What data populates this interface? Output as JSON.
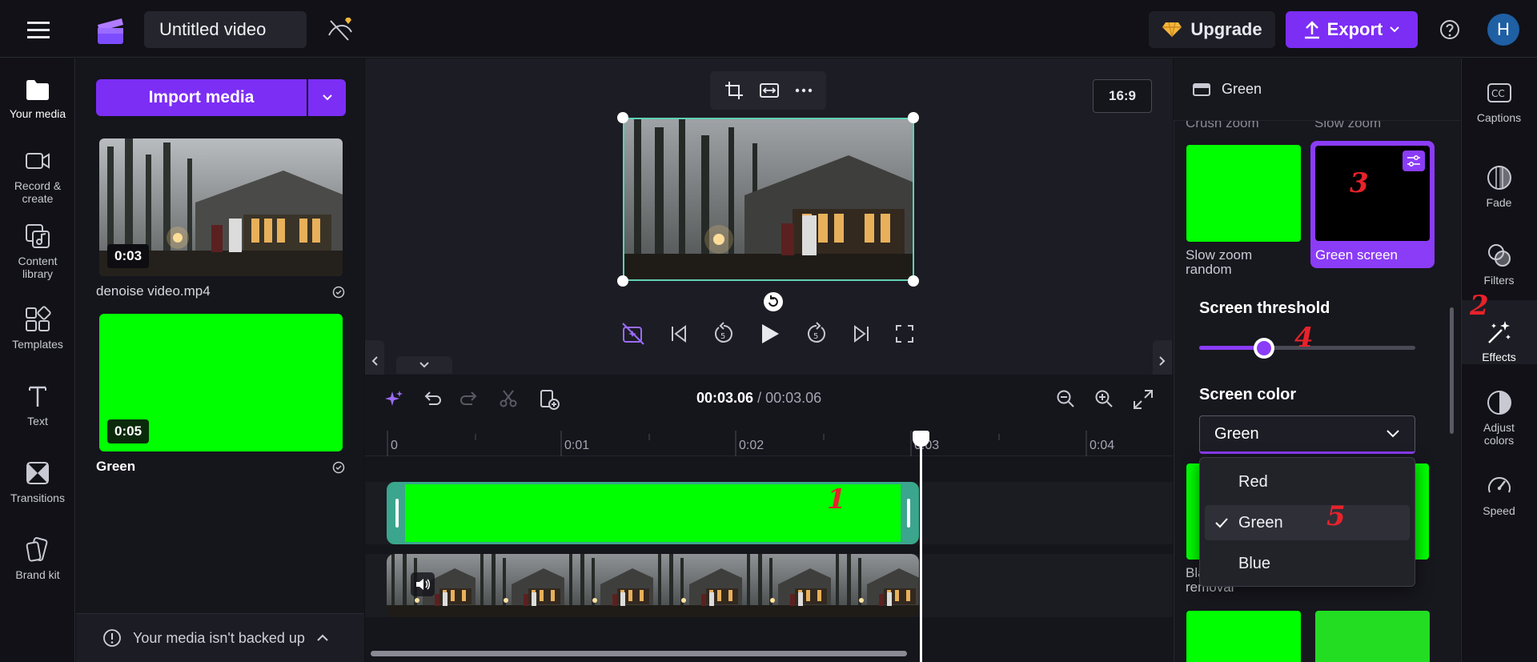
{
  "header": {
    "project_title": "Untitled video",
    "upgrade_label": "Upgrade",
    "export_label": "Export",
    "avatar_initial": "H"
  },
  "left_nav": {
    "items": [
      {
        "label": "Your media",
        "icon": "folder-icon"
      },
      {
        "label": "Record &\ncreate",
        "icon": "camera-icon"
      },
      {
        "label": "Content\nlibrary",
        "icon": "content-library-icon"
      },
      {
        "label": "Templates",
        "icon": "templates-icon"
      },
      {
        "label": "Text",
        "icon": "text-icon"
      },
      {
        "label": "Transitions",
        "icon": "transitions-icon"
      },
      {
        "label": "Brand kit",
        "icon": "brand-kit-icon"
      }
    ]
  },
  "media": {
    "import_label": "Import media",
    "items": [
      {
        "name": "denoise video.mp4",
        "duration": "0:03"
      },
      {
        "name": "Green",
        "duration": "0:05"
      }
    ],
    "backup_text": "Your media isn't backed up"
  },
  "preview": {
    "aspect_ratio": "16:9"
  },
  "timeline": {
    "current_time": "00:03.06",
    "separator": " / ",
    "total_time": "00:03.06",
    "ticks": [
      "0",
      "0:01",
      "0:02",
      "0:03",
      "0:04"
    ]
  },
  "properties": {
    "title": "Green",
    "scrolled_labels": [
      "Crush zoom",
      "Slow zoom"
    ],
    "effects": [
      {
        "label": "Slow zoom\nrandom",
        "selected": false
      },
      {
        "label": "Green screen",
        "selected": true
      }
    ],
    "partial_label": "Bla\nremoval",
    "threshold_label": "Screen threshold",
    "threshold_value": 0.3,
    "color_label": "Screen color",
    "color_selected": "Green",
    "color_options": [
      "Red",
      "Green",
      "Blue"
    ]
  },
  "right_rail": {
    "items": [
      {
        "label": "Captions",
        "icon": "captions-icon"
      },
      {
        "label": "Fade",
        "icon": "fade-icon"
      },
      {
        "label": "Filters",
        "icon": "filters-icon"
      },
      {
        "label": "Effects",
        "icon": "effects-wand-icon"
      },
      {
        "label": "Adjust\ncolors",
        "icon": "adjust-colors-icon"
      },
      {
        "label": "Speed",
        "icon": "speed-icon"
      }
    ]
  },
  "annotations": [
    "1",
    "2",
    "3",
    "4",
    "5"
  ],
  "colors": {
    "accent": "#7c2ef5",
    "green_screen": "#00ff00",
    "clip_border": "#3ba58d",
    "annotation": "#e8222a"
  }
}
